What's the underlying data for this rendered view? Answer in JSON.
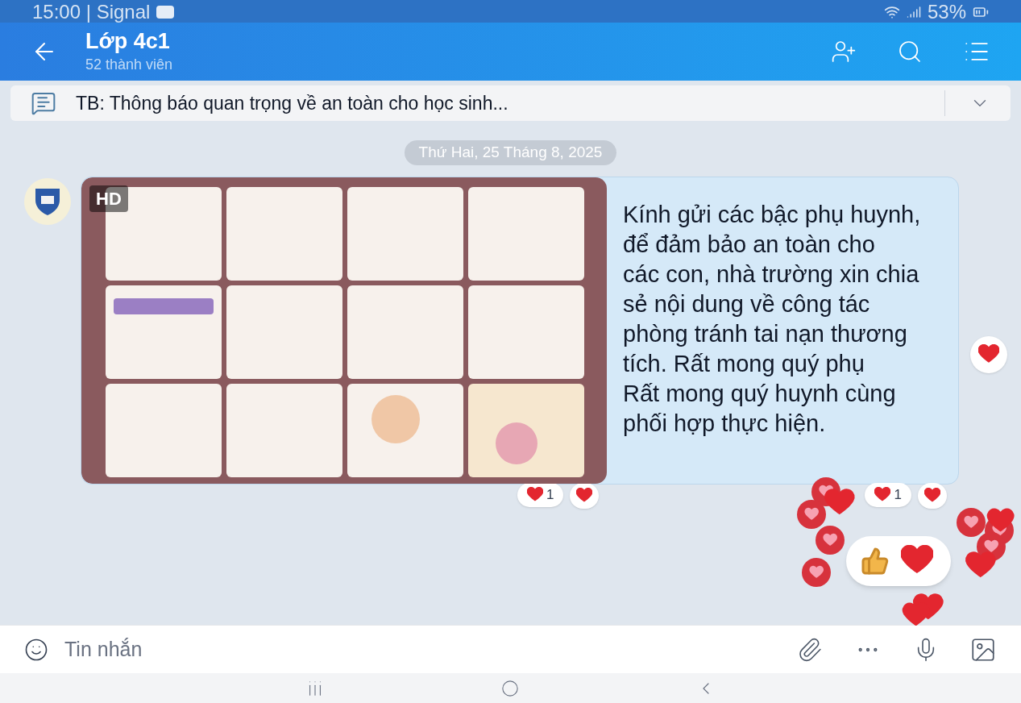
{
  "status_bar": {
    "time_carrier": "15:00 | Signal",
    "battery": "53%"
  },
  "header": {
    "title": "Lớp 4c1",
    "subtitle": "52 thành viên"
  },
  "pinned": {
    "text": "TB: Thông báo quan trọng về an toàn cho học sinh..."
  },
  "date_separator": "Thứ Hai, 25 Tháng 8, 2025",
  "message": {
    "image": {
      "kind": "picture",
      "badge": "HD",
      "reaction_count": "1"
    },
    "text": "Kính gửi các bậc phụ huynh,\nđể đảm bảo an toàn cho\ncác con, nhà trường xin chia\nsẻ nội dung về công tác\nphòng tránh tai nạn thương\ntích. Rất mong quý phụ\nRất mong quý huynh cùng\nphối hợp thực hiện.",
    "text_reaction_count": "1"
  },
  "composer": {
    "placeholder": "Tin nhắn"
  }
}
